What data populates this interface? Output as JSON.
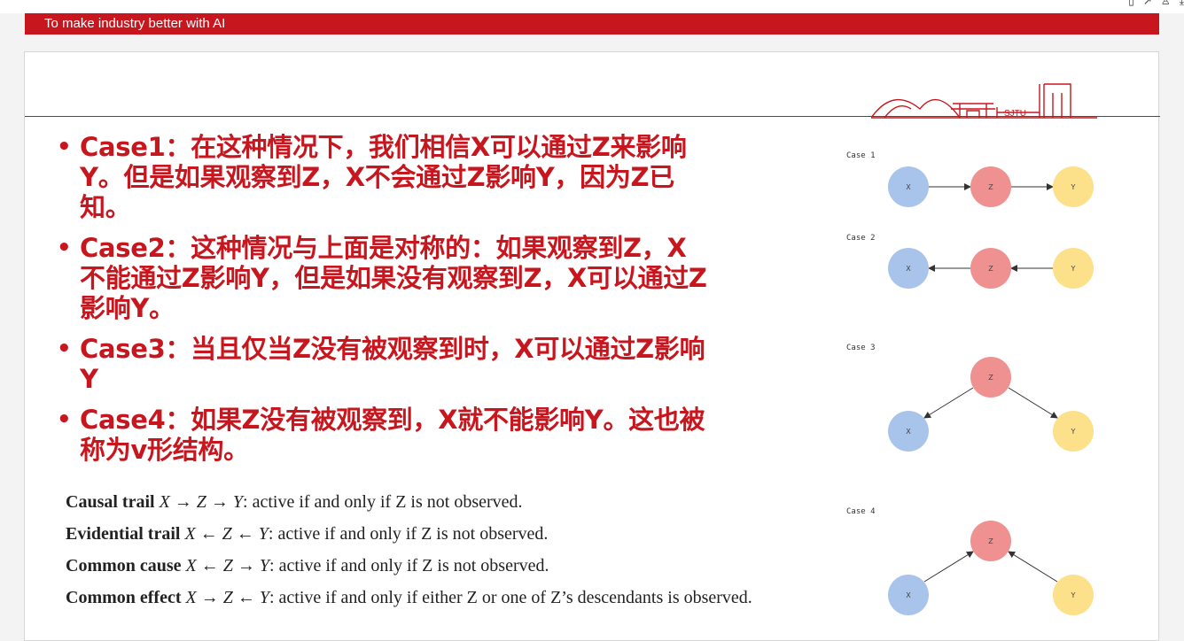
{
  "banner": {
    "text": "To make industry better with AI"
  },
  "bullets": [
    "Case1：在这种情况下，我们相信X可以通过Z来影响Y。但是如果观察到Z，X不会通过Z影响Y，因为Z已知。",
    "Case2：这种情况与上面是对称的：如果观察到Z，X不能通过Z影响Y，但是如果没有观察到Z，X可以通过Z影响Y。",
    "Case3：当且仅当Z没有被观察到时，X可以通过Z影响Y",
    "Case4：如果Z没有被观察到，X就不能影响Y。这也被称为v形结构。"
  ],
  "trails": [
    {
      "name": "Causal trail",
      "formula": "X → Z → Y",
      "desc": ": active if and only if Z is not observed."
    },
    {
      "name": "Evidential trail",
      "formula": "X ← Z ← Y",
      "desc": ": active if and only if Z is not observed."
    },
    {
      "name": "Common cause",
      "formula": "X ← Z → Y",
      "desc": ": active if and only if Z is not observed."
    },
    {
      "name": "Common effect",
      "formula": "X → Z ← Y",
      "desc": ": active if and only if either Z or one of Z’s descendants is observed."
    }
  ],
  "cases": [
    {
      "label": "Case 1",
      "nodes": [
        "X",
        "Z",
        "Y"
      ]
    },
    {
      "label": "Case 2",
      "nodes": [
        "X",
        "Z",
        "Y"
      ]
    },
    {
      "label": "Case 3",
      "nodes": [
        "X",
        "Z",
        "Y"
      ]
    },
    {
      "label": "Case 4",
      "nodes": [
        "X",
        "Z",
        "Y"
      ]
    }
  ],
  "colors": {
    "accent": "#c8161e",
    "node_x": "#a9c4ea",
    "node_z": "#ef9191",
    "node_y": "#fde08a"
  }
}
